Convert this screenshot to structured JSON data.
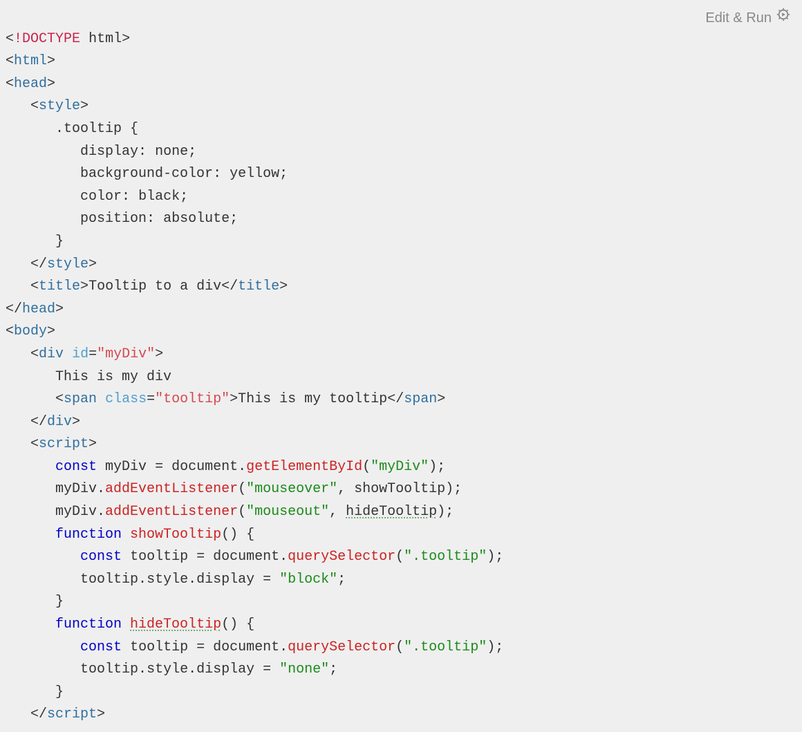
{
  "editRun": "Edit & Run",
  "code": {
    "doctype": "DOCTYPE",
    "htmlWord": "html",
    "tags": {
      "html": "html",
      "head": "head",
      "style": "style",
      "title": "title",
      "body": "body",
      "div": "div",
      "span": "span",
      "script": "script"
    },
    "attrs": {
      "id": "id",
      "class": "class"
    },
    "vals": {
      "myDiv": "\"myDiv\"",
      "tooltip": "\"tooltip\""
    },
    "css": {
      "selector": ".tooltip",
      "display": "display",
      "displayVal": "none",
      "bg": "background-color",
      "bgVal": "yellow",
      "color": "color",
      "colorVal": "black",
      "pos": "position",
      "posVal": "absolute"
    },
    "titleText": "Tooltip to a div",
    "divText": "This is my div",
    "spanText": "This is my tooltip",
    "js": {
      "const": "const",
      "function": "function",
      "myDiv": "myDiv",
      "tooltip": "tooltip",
      "document": "document",
      "getElementById": "getElementById",
      "addEventListener": "addEventListener",
      "querySelector": "querySelector",
      "showTooltip": "showTooltip",
      "hideTooltip": "hideTooltip",
      "style": "style",
      "display": "display",
      "strMyDiv": "\"myDiv\"",
      "strMouseover": "\"mouseover\"",
      "strMouseout": "\"mouseout\"",
      "strTooltipSel": "\".tooltip\"",
      "strBlock": "\"block\"",
      "strNone": "\"none\""
    }
  }
}
